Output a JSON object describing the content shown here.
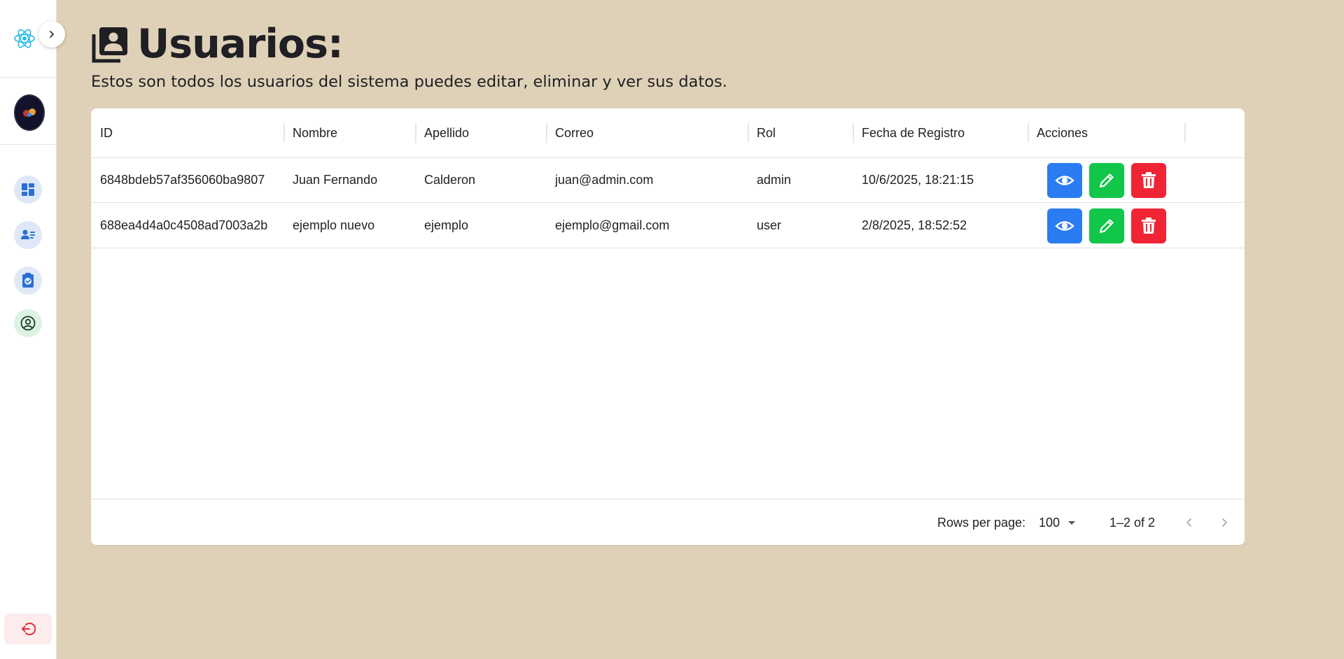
{
  "page": {
    "title": "Usuarios:",
    "subtitle": "Estos son todos los usuarios del sistema puedes editar, eliminar y ver sus datos."
  },
  "sidebar": {
    "logo_icon": "react-logo-icon",
    "toggle_icon": "chevron-right-icon",
    "nav": [
      {
        "icon": "dashboard-icon",
        "color": "#2b6fd6",
        "bg": "#dfe8f6"
      },
      {
        "icon": "users-list-icon",
        "color": "#2b6fd6",
        "bg": "#dfe8f6"
      },
      {
        "icon": "clipboard-check-icon",
        "color": "#2b6fd6",
        "bg": "#dfe8f6"
      },
      {
        "icon": "user-circle-icon",
        "color": "#1b3a2a",
        "bg": "#dcf3e3"
      }
    ],
    "logout_icon": "logout-icon"
  },
  "table": {
    "columns": [
      "ID",
      "Nombre",
      "Apellido",
      "Correo",
      "Rol",
      "Fecha de Registro",
      "Acciones"
    ],
    "rows": [
      {
        "id": "6848bdeb57af356060ba9807",
        "nombre": "Juan Fernando",
        "apellido": "Calderon",
        "correo": "juan@admin.com",
        "rol": "admin",
        "fecha": "10/6/2025, 18:21:15"
      },
      {
        "id": "688ea4d4a0c4508ad7003a2b",
        "nombre": "ejemplo nuevo",
        "apellido": "ejemplo",
        "correo": "ejemplo@gmail.com",
        "rol": "user",
        "fecha": "2/8/2025, 18:52:52"
      }
    ],
    "actions": {
      "view_icon": "eye-icon",
      "view_color": "#2b7cf2",
      "edit_icon": "pencil-icon",
      "edit_color": "#12c64a",
      "delete_icon": "trash-icon",
      "delete_color": "#ef2535"
    }
  },
  "pagination": {
    "rows_per_page_label": "Rows per page:",
    "rows_per_page_value": "100",
    "range": "1–2 of 2"
  }
}
